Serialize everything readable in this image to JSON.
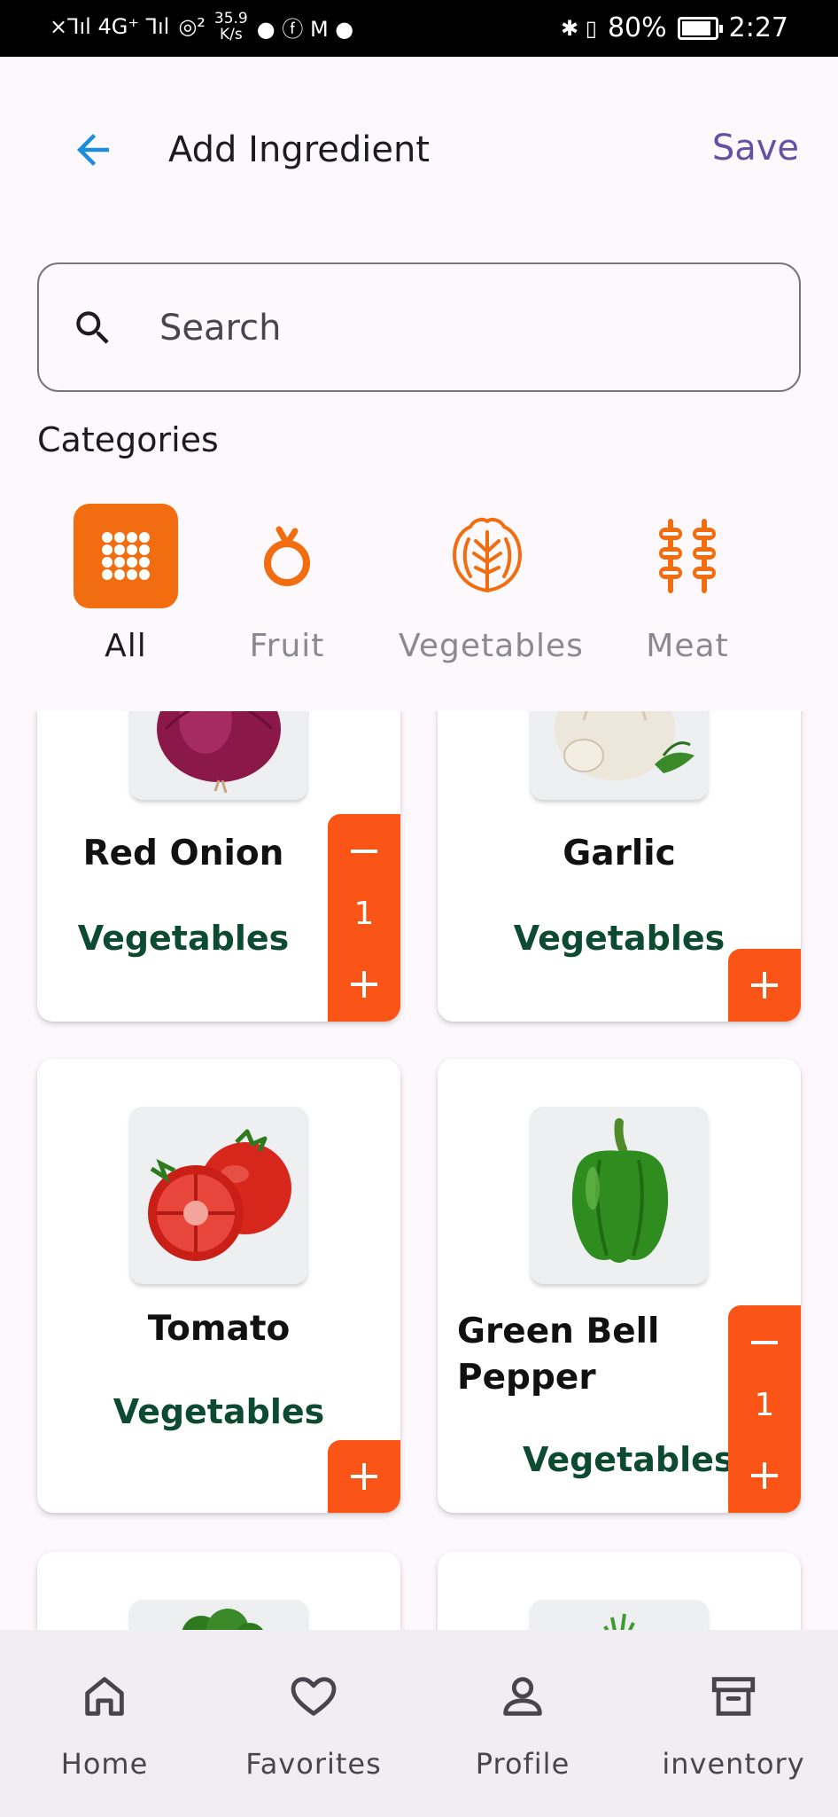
{
  "status_bar": {
    "signal": "×⅂ıl 4G⁺ ⅂ıl",
    "hotspot": "◎²",
    "speed_value": "35.9",
    "speed_unit": "K/s",
    "app_icons": "● ⓕ M ●",
    "connectivity": "✱ ▯",
    "battery_percent_text": "80%",
    "battery_level": 0.8,
    "time": "2:27"
  },
  "appbar": {
    "title": "Add Ingredient",
    "save_label": "Save",
    "back_icon": "arrow-left-icon"
  },
  "search": {
    "placeholder": "Search",
    "value": ""
  },
  "categories": {
    "heading": "Categories",
    "items": [
      {
        "label": "All",
        "icon": "grid-icon",
        "active": true
      },
      {
        "label": "Fruit",
        "icon": "fruit-icon",
        "active": false
      },
      {
        "label": "Vegetables",
        "icon": "lettuce-icon",
        "active": false
      },
      {
        "label": "Meat",
        "icon": "skewer-icon",
        "active": false
      }
    ]
  },
  "ingredients": [
    {
      "name": "Red Onion",
      "category": "Vegetables",
      "quantity": "1",
      "image": "red-onion-image"
    },
    {
      "name": "Garlic",
      "category": "Vegetables",
      "quantity": "",
      "image": "garlic-image"
    },
    {
      "name": "Tomato",
      "category": "Vegetables",
      "quantity": "",
      "image": "tomato-image"
    },
    {
      "name": "Green Bell Pepper",
      "category": "Vegetables",
      "quantity": "1",
      "image": "green-bell-pepper-image"
    },
    {
      "name": "",
      "category": "",
      "quantity": "",
      "image": "broccoli-image"
    },
    {
      "name": "",
      "category": "",
      "quantity": "",
      "image": "carrot-image"
    }
  ],
  "bottom_nav": [
    {
      "label": "Home",
      "icon": "home-icon"
    },
    {
      "label": "Favorites",
      "icon": "heart-icon"
    },
    {
      "label": "Profile",
      "icon": "person-icon"
    },
    {
      "label": "inventory",
      "icon": "archive-box-icon"
    }
  ],
  "colors": {
    "accent_orange": "#f26d0f",
    "button_orange": "#fa5517",
    "category_green": "#0d4a32",
    "save_purple": "#6750a4",
    "back_blue": "#1a8ddb"
  }
}
